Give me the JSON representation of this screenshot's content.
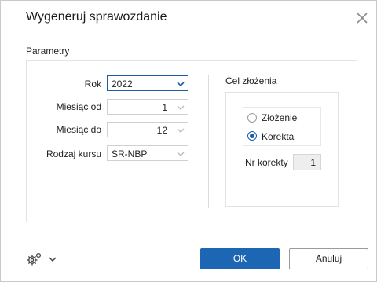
{
  "dialog": {
    "title": "Wygeneruj sprawozdanie",
    "close_icon": "close-icon"
  },
  "parametry": {
    "section_label": "Parametry",
    "fields": {
      "rok": {
        "label": "Rok",
        "value": "2022"
      },
      "miesiac_od": {
        "label": "Miesiąc od",
        "value": "1"
      },
      "miesiac_do": {
        "label": "Miesiąc do",
        "value": "12"
      },
      "rodzaj_kursu": {
        "label": "Rodzaj kursu",
        "value": "SR-NBP"
      }
    }
  },
  "cel": {
    "title": "Cel złożenia",
    "options": [
      {
        "label": "Złożenie",
        "checked": false
      },
      {
        "label": "Korekta",
        "checked": true
      }
    ],
    "nr_korekty": {
      "label": "Nr korekty",
      "value": "1"
    }
  },
  "footer": {
    "settings_icon": "gear-icon",
    "ok_label": "OK",
    "cancel_label": "Anuluj"
  },
  "colors": {
    "accent": "#1c66b3",
    "border": "#c9c9c9"
  }
}
